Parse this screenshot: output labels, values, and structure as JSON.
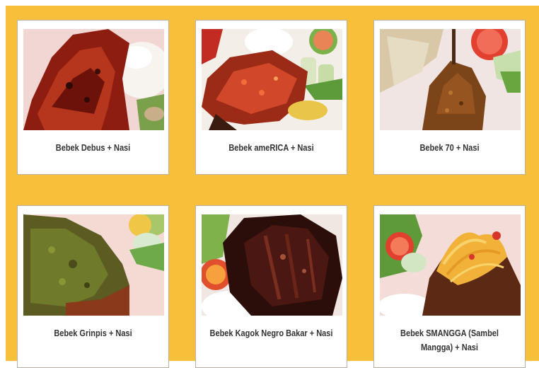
{
  "menu": {
    "items": [
      {
        "title": "Bebek Debus + Nasi",
        "photo_icon": "grilled-duck-red-glaze-icon"
      },
      {
        "title": "Bebek ameRICA + Nasi",
        "photo_icon": "duck-chili-sauce-icon"
      },
      {
        "title": "Bebek 70 + Nasi",
        "photo_icon": "duck-crispy-floss-icon"
      },
      {
        "title": "Bebek Grinpis + Nasi",
        "photo_icon": "duck-green-sambal-icon"
      },
      {
        "title": "Bebek Kagok Negro Bakar + Nasi",
        "photo_icon": "black-grilled-duck-icon"
      },
      {
        "title": "Bebek SMANGGA (Sambel Mangga) + Nasi",
        "photo_icon": "duck-mango-sambal-icon"
      }
    ]
  },
  "colors": {
    "panel_background": "#f8bf3b",
    "card_background": "#ffffff",
    "card_border": "#b9b2a4",
    "caption_text": "#333333"
  }
}
